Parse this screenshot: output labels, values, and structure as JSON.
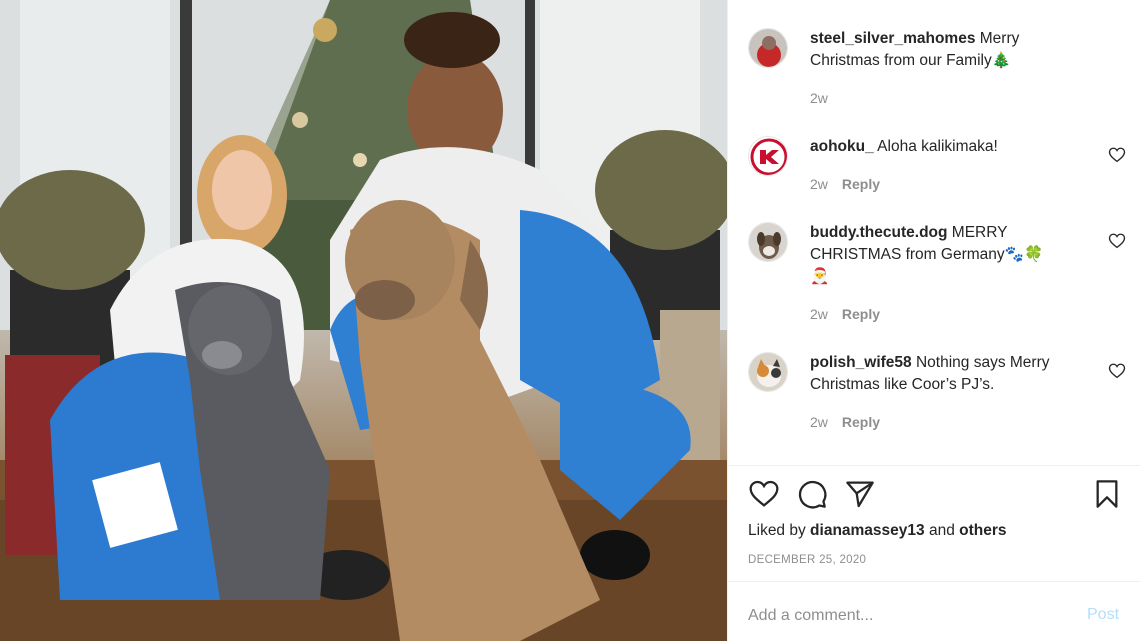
{
  "post": {
    "caption_user": "steel_silver_mahomes",
    "caption_text": " Merry Christmas from our Family",
    "caption_emoji": "🎄",
    "caption_time": "2w"
  },
  "comments": [
    {
      "username": "aohoku_",
      "text": " Aloha kalikimaka!",
      "time": "2w",
      "reply_label": "Reply",
      "avatar_icon": "chiefs-logo-icon"
    },
    {
      "username": "buddy.thecute.dog",
      "text": " MERRY CHRISTMAS from Germany",
      "emojis": "🐾🍀",
      "emoji_line2": "🎅",
      "time": "2w",
      "reply_label": "Reply",
      "avatar_icon": "dog-avatar-icon"
    },
    {
      "username": "polish_wife58",
      "text": " Nothing says Merry Christmas like Coor’s PJ’s.",
      "time": "2w",
      "reply_label": "Reply",
      "avatar_icon": "cat-avatar-icon"
    }
  ],
  "actions": {
    "like_icon": "heart-icon",
    "comment_icon": "comment-icon",
    "share_icon": "share-icon",
    "save_icon": "bookmark-icon"
  },
  "likes": {
    "prefix": "Liked by ",
    "user": "dianamassey13",
    "middle": " and ",
    "others": "others"
  },
  "date": "DECEMBER 25, 2020",
  "composer": {
    "placeholder": "Add a comment...",
    "post_label": "Post"
  },
  "colors": {
    "text": "#262626",
    "muted": "#8e8e8e",
    "post_disabled": "#b2dffc",
    "divider": "#efefef"
  }
}
